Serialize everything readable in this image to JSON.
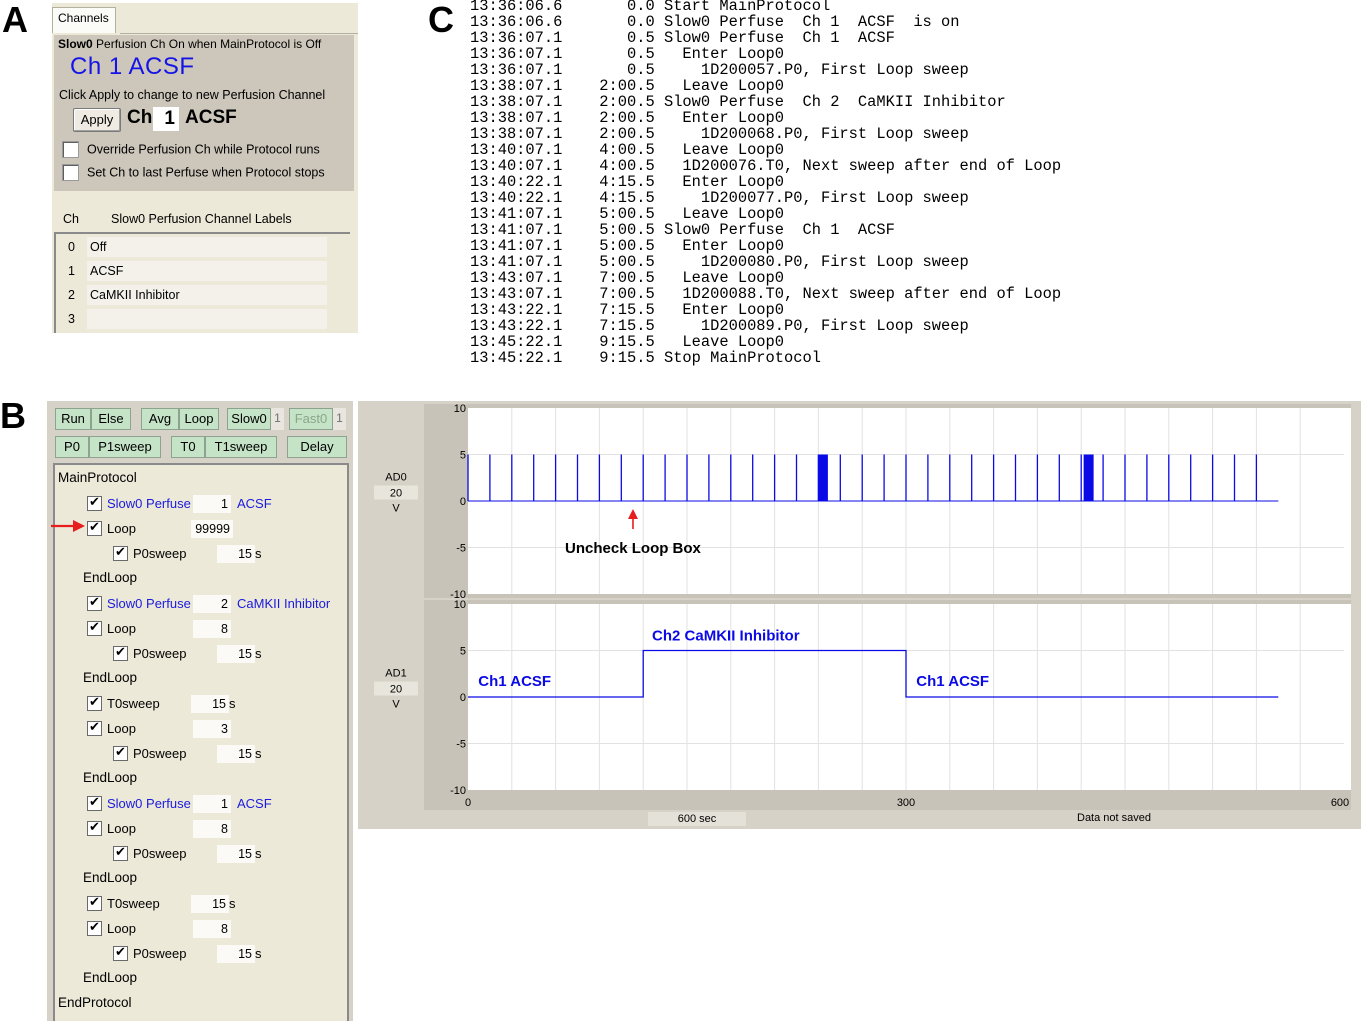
{
  "panel_letters": {
    "a": "A",
    "b": "B",
    "c": "C"
  },
  "panel_a": {
    "tab_label": "Channels",
    "status_device": "Slow0",
    "status_text": "Perfusion Ch On when MainProtocol is Off",
    "current_channel": "Ch 1   ACSF",
    "hint": "Click Apply to change to new Perfusion Channel",
    "apply_label": "Apply",
    "ch_label": "Ch",
    "ch_value": "1",
    "ch_name": "ACSF",
    "option_override": "Override Perfusion Ch while Protocol runs",
    "option_last": "Set Ch to last Perfuse when Protocol stops",
    "labels_header_ch": "Ch",
    "labels_header_title": "Slow0 Perfusion Channel Labels",
    "channel_labels": [
      {
        "num": "0",
        "label": "Off"
      },
      {
        "num": "1",
        "label": "ACSF"
      },
      {
        "num": "2",
        "label": "CaMKII Inhibitor"
      },
      {
        "num": "3",
        "label": ""
      }
    ]
  },
  "panel_c": {
    "log": [
      "13:36:06.6       0.0 Start MainProtocol",
      "13:36:06.6       0.0 Slow0 Perfuse  Ch 1  ACSF  is on",
      "13:36:07.1       0.5 Slow0 Perfuse  Ch 1  ACSF",
      "13:36:07.1       0.5   Enter Loop0",
      "13:36:07.1       0.5     1D200057.P0, First Loop sweep",
      "13:38:07.1    2:00.5   Leave Loop0",
      "13:38:07.1    2:00.5 Slow0 Perfuse  Ch 2  CaMKII Inhibitor",
      "13:38:07.1    2:00.5   Enter Loop0",
      "13:38:07.1    2:00.5     1D200068.P0, First Loop sweep",
      "13:40:07.1    4:00.5   Leave Loop0",
      "13:40:07.1    4:00.5   1D200076.T0, Next sweep after end of Loop",
      "13:40:22.1    4:15.5   Enter Loop0",
      "13:40:22.1    4:15.5     1D200077.P0, First Loop sweep",
      "13:41:07.1    5:00.5   Leave Loop0",
      "13:41:07.1    5:00.5 Slow0 Perfuse  Ch 1  ACSF",
      "13:41:07.1    5:00.5   Enter Loop0",
      "13:41:07.1    5:00.5     1D200080.P0, First Loop sweep",
      "13:43:07.1    7:00.5   Leave Loop0",
      "13:43:07.1    7:00.5   1D200088.T0, Next sweep after end of Loop",
      "13:43:22.1    7:15.5   Enter Loop0",
      "13:43:22.1    7:15.5     1D200089.P0, First Loop sweep",
      "13:45:22.1    9:15.5   Leave Loop0",
      "13:45:22.1    9:15.5 Stop MainProtocol"
    ]
  },
  "panel_b": {
    "toolbar_row1": [
      {
        "label": "Run"
      },
      {
        "label": "Else"
      },
      {
        "label": "Avg"
      },
      {
        "label": "Loop"
      },
      {
        "label": "Slow0"
      },
      {
        "label": "1"
      },
      {
        "label": "Fast0"
      },
      {
        "label": "1"
      }
    ],
    "toolbar_row2": [
      {
        "label": "P0"
      },
      {
        "label": "P1sweep"
      },
      {
        "label": "T0"
      },
      {
        "label": "T1sweep"
      },
      {
        "label": "Delay"
      }
    ],
    "protocol_title": "MainProtocol",
    "protocol_end": "EndProtocol",
    "endloop_label": "EndLoop",
    "rows": [
      {
        "type": "perfuse",
        "label": "Slow0 Perfuse",
        "value": "1",
        "name": "ACSF"
      },
      {
        "type": "loop",
        "label": "Loop",
        "value": "99999"
      },
      {
        "type": "sweep",
        "label": "P0sweep",
        "value": "15",
        "unit": "s"
      },
      {
        "type": "endloop"
      },
      {
        "type": "perfuse",
        "label": "Slow0 Perfuse",
        "value": "2",
        "name": "CaMKII Inhibitor"
      },
      {
        "type": "loop",
        "label": "Loop",
        "value": "8"
      },
      {
        "type": "sweep",
        "label": "P0sweep",
        "value": "15",
        "unit": "s"
      },
      {
        "type": "endloop"
      },
      {
        "type": "tsweep",
        "label": "T0sweep",
        "value": "15",
        "unit": "s"
      },
      {
        "type": "loop",
        "label": "Loop",
        "value": "3"
      },
      {
        "type": "sweep",
        "label": "P0sweep",
        "value": "15",
        "unit": "s"
      },
      {
        "type": "endloop"
      },
      {
        "type": "perfuse",
        "label": "Slow0 Perfuse",
        "value": "1",
        "name": "ACSF"
      },
      {
        "type": "loop",
        "label": "Loop",
        "value": "8"
      },
      {
        "type": "sweep",
        "label": "P0sweep",
        "value": "15",
        "unit": "s"
      },
      {
        "type": "endloop"
      },
      {
        "type": "tsweep",
        "label": "T0sweep",
        "value": "15",
        "unit": "s"
      },
      {
        "type": "loop",
        "label": "Loop",
        "value": "8"
      },
      {
        "type": "sweep",
        "label": "P0sweep",
        "value": "15",
        "unit": "s"
      },
      {
        "type": "endloop"
      }
    ],
    "annotation_color": "#e61e1e"
  },
  "chart_data": [
    {
      "type": "line",
      "channel_label": "AD0",
      "range_label": "20",
      "unit_label": "V",
      "xlim": [
        0,
        600
      ],
      "ylim": [
        -10,
        10
      ],
      "yticks": [
        "10",
        "5",
        "0",
        "-5",
        "-10"
      ],
      "pulse_height": 5,
      "pulse_times": [
        0,
        15,
        30,
        45,
        60,
        75,
        90,
        105,
        120,
        135,
        150,
        165,
        180,
        195,
        210,
        225,
        240,
        255,
        270,
        285,
        300,
        315,
        330,
        345,
        360,
        375,
        390,
        405,
        420,
        435,
        450,
        465,
        480,
        495,
        510,
        525,
        540
      ],
      "extra_pulses": [
        240,
        422
      ],
      "end_time": 555,
      "annotation": "Uncheck Loop Box",
      "annotation_x": 113,
      "color": "#0a0ae6"
    },
    {
      "type": "line",
      "channel_label": "AD1",
      "range_label": "20",
      "unit_label": "V",
      "xlim": [
        0,
        600
      ],
      "ylim": [
        -10,
        10
      ],
      "yticks": [
        "10",
        "5",
        "0",
        "-5",
        "-10"
      ],
      "xticks": [
        "0",
        "300",
        "600"
      ],
      "step_points": [
        [
          0,
          0
        ],
        [
          120,
          0
        ],
        [
          120,
          5
        ],
        [
          300,
          5
        ],
        [
          300,
          0
        ],
        [
          555,
          0
        ]
      ],
      "annotations": [
        {
          "text": "Ch1  ACSF",
          "x": 5,
          "y": 1.2
        },
        {
          "text": "Ch2  CaMKII Inhibitor",
          "x": 124,
          "y": 6.1
        },
        {
          "text": "Ch1  ACSF",
          "x": 305,
          "y": 1.2
        }
      ],
      "color": "#0a0ae6"
    }
  ],
  "plot_footer": {
    "duration": "600 sec",
    "status": "Data not saved"
  }
}
